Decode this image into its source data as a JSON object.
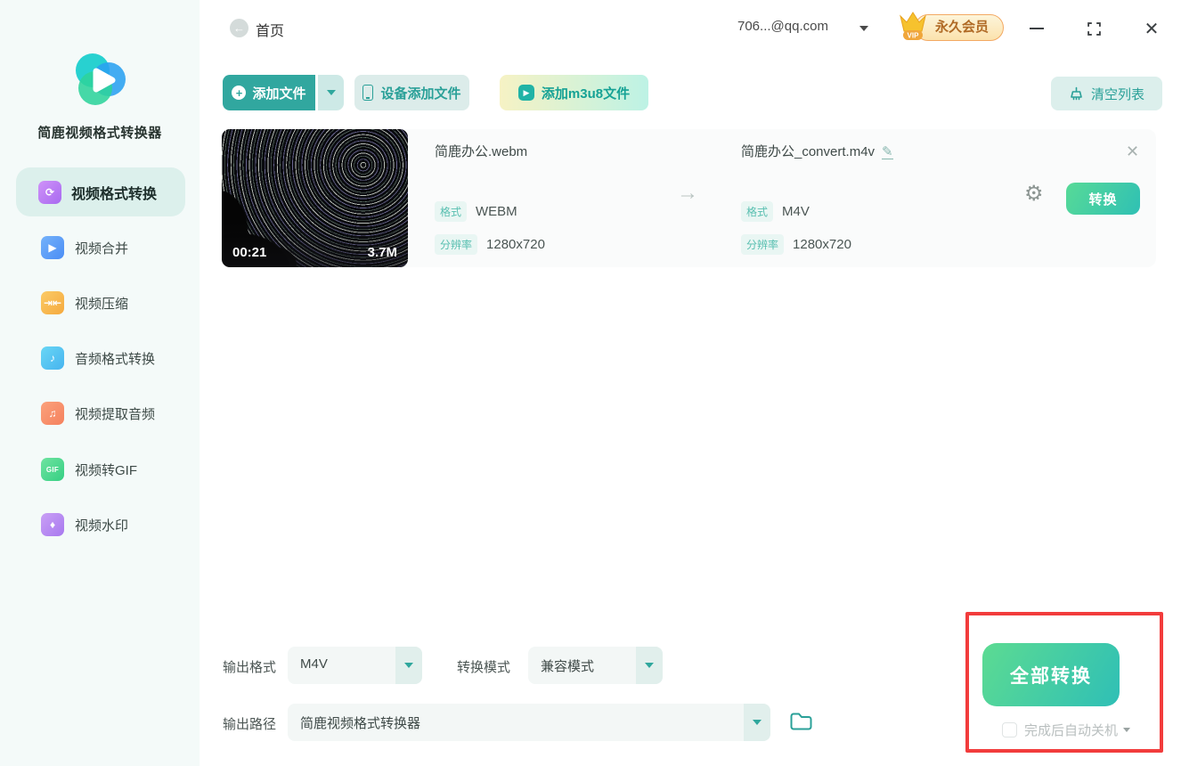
{
  "titlebar": {
    "home_label": "首页",
    "account": "706...@qq.com",
    "vip_label": "永久会员",
    "vip_ribbon": "VIP"
  },
  "sidebar": {
    "app_name": "简鹿视频格式转换器",
    "items": [
      {
        "label": "视频格式转换",
        "icon": "video-convert-icon",
        "active": true
      },
      {
        "label": "视频合并",
        "icon": "video-merge-icon",
        "active": false
      },
      {
        "label": "视频压缩",
        "icon": "video-compress-icon",
        "active": false
      },
      {
        "label": "音频格式转换",
        "icon": "audio-convert-icon",
        "active": false
      },
      {
        "label": "视频提取音频",
        "icon": "extract-audio-icon",
        "active": false
      },
      {
        "label": "视频转GIF",
        "icon": "video-to-gif-icon",
        "active": false
      },
      {
        "label": "视频水印",
        "icon": "watermark-icon",
        "active": false
      }
    ]
  },
  "toolbar": {
    "add_file": "添加文件",
    "add_from_device": "设备添加文件",
    "add_m3u8": "添加m3u8文件",
    "clear_list": "清空列表"
  },
  "file_item": {
    "duration": "00:21",
    "size": "3.7M",
    "source": {
      "name": "简鹿办公.webm",
      "format_label": "格式",
      "format": "WEBM",
      "resolution_label": "分辨率",
      "resolution": "1280x720"
    },
    "output": {
      "name": "简鹿办公_convert.m4v",
      "format_label": "格式",
      "format": "M4V",
      "resolution_label": "分辨率",
      "resolution": "1280x720"
    },
    "convert_button": "转换"
  },
  "footer": {
    "output_format_label": "输出格式",
    "output_format_value": "M4V",
    "convert_mode_label": "转换模式",
    "convert_mode_value": "兼容模式",
    "output_path_label": "输出路径",
    "output_path_value": "简鹿视频格式转换器",
    "convert_all_button": "全部转换",
    "shutdown_label": "完成后自动关机"
  },
  "colors": {
    "accent_teal": "#2aa098",
    "button_teal": "#31a79f",
    "green_gradient_start": "#5cdb92",
    "green_gradient_end": "#2fbfb6",
    "sidebar_bg": "#f4faf9",
    "active_item_bg": "#dcf0ec",
    "tag_bg": "#e9f6f3",
    "tag_text": "#58bfb0",
    "vip_text": "#b06a25",
    "annotation_red": "#f23c3c"
  }
}
